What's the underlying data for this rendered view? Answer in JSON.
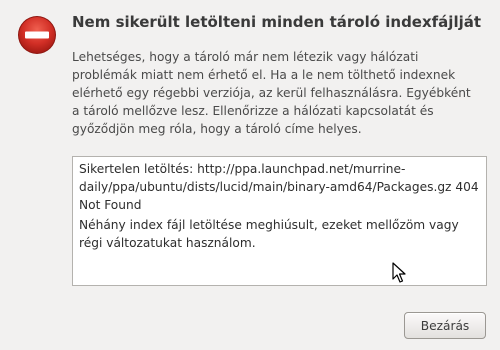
{
  "dialog": {
    "icon": "error-icon",
    "title": "Nem sikerült letölteni minden tároló indexfájlját",
    "message": "Lehetséges, hogy a tároló már nem létezik vagy hálózati problémák miatt nem érhető el. Ha a le nem tölthető indexnek elérhető egy régebbi verziója, az kerül felhasználásra. Egyébként a tároló mellőzve lesz. Ellenőrizze a hálózati kapcsolatát és győződjön meg róla, hogy a tároló címe helyes.",
    "details": {
      "error_line": "Sikertelen letöltés: http://ppa.launchpad.net/murrine-daily/ppa/ubuntu/dists/lucid/main/binary-amd64/Packages.gz  404  Not Found",
      "summary_line": "Néhány index fájl letöltése meghiúsult, ezeket mellőzöm vagy régi változatukat használom."
    },
    "close_label": "Bezárás"
  },
  "colors": {
    "background": "#f2f1f0",
    "error_red": "#d22f26",
    "text": "#3c3c3c"
  }
}
